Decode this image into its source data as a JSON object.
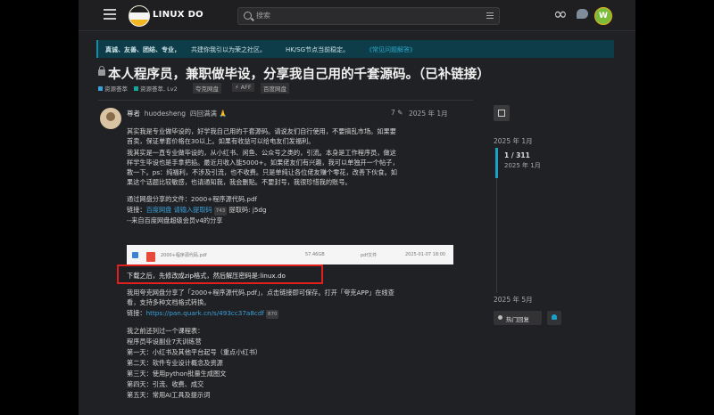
{
  "header": {
    "logo_text": "LINUX DO",
    "search_placeholder": "搜索",
    "avatar_letter": "W"
  },
  "banner": {
    "part1": "真诚、友善、团结、专业，",
    "part2": "共建你我引以为荣之社区。",
    "part3": "HK/SG节点当前稳定。",
    "link": "《常见问题解答》"
  },
  "topic": {
    "title": "本人程序员，兼职做毕设，分享我自己用的千套源码。（已补链接）",
    "category": "资源荟萃",
    "subcategory": "资源荟萃, Lv2",
    "tags": [
      "夸克网盘",
      "AFF",
      "百度网盘"
    ]
  },
  "post": {
    "author_name": "尊者",
    "author_handle": "huodesheng",
    "author_extra": "四回满满 🙏",
    "edit_count": "7",
    "date": "2025 年 1月",
    "lines": [
      "其实我是专业做毕设的，好学我自己用的干套源码。请说友们自行使用，不要搞乱市场。如果要",
      "首卖，保证单套价格在30以上。如果有收益可以给电友们发福利。",
      "我其实是一直专业做毕设的，从小红书、闲鱼、公众号之类的，引流。本身是工作程序员，做这",
      "样学生毕设也是手拿把掐。最近月收入能5000+。如果佬友们有兴趣，我可以单独开一个帖子，",
      "教一下。ps：纯福利，不涉及引流，也不收费。只是单纯让各位佬友赚个零花，改善下伙食。如",
      "果这个话题比较敏感，也请通知我，我会删贴。不要封号，我很珍惜我的账号。"
    ],
    "share_line": "通过网盘分享的文件：2000+程序源代码.pdf",
    "link_prefix": "链接：",
    "link_text": "百度网盘 请输入提取码",
    "link_count": "743",
    "code_text": "提取码: j5dg",
    "note_line": "--来自百度网盘超级会员v4的分享",
    "file_name": "2000+程序源代码.pdf",
    "file_size": "57.46GB",
    "file_type": "pdf文件",
    "file_date": "2025-01-07 18:00",
    "highlight": "下载之后，先修改成zip格式，然后解压密码是:linux.do",
    "quark_line1": "我用夸克网盘分享了「2000+程序源代码.pdf」，点击链接即可保存。打开「夸克APP」在线查",
    "quark_line2": "看，支持多种文档格式转换。",
    "quark_link_prefix": "链接：",
    "quark_link": "https://pan.quark.cn/s/493cc37a8cdf",
    "quark_count": "870",
    "course_intro": "我之前还列过一个课程表：",
    "course_title": "程序员毕设副业7天训练营",
    "days": [
      "第一天：小红书及其他平台起号（重点小红书）",
      "第二天：软件专业设计概念及资源",
      "第三天：使用python批量生成图文",
      "第四天：引流、收费、成交",
      "第五天：常用AI工具及提示词"
    ]
  },
  "timeline": {
    "start_date": "2025 年 1月",
    "progress": "1 / 311",
    "current_date": "2025 年 1月",
    "end_date": "2025 年 5月",
    "hot_label": "热门回复"
  },
  "colors": {
    "accent": "#1aa1c6",
    "link": "#3aa0d8",
    "highlight_border": "#e0201e"
  }
}
